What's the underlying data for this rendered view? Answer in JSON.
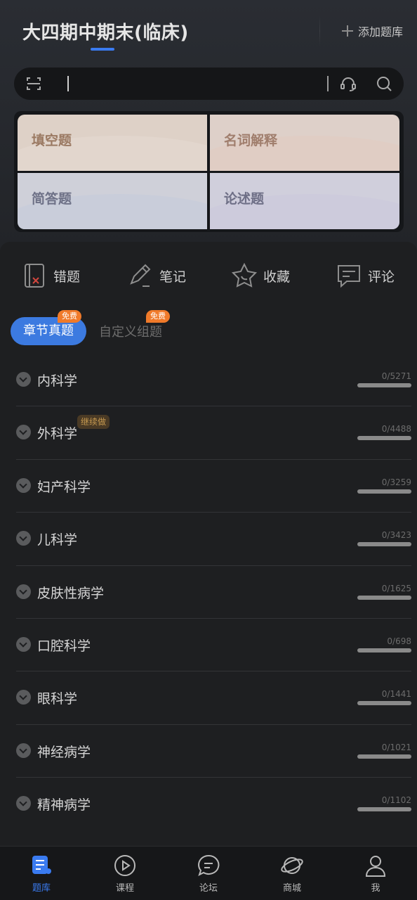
{
  "header": {
    "title": "大四期中期末(临床)",
    "add_bank_label": "添加题库"
  },
  "search": {
    "value": "",
    "icons": [
      "scan-icon",
      "headset-icon",
      "search-icon"
    ]
  },
  "categories": [
    {
      "label": "填空题"
    },
    {
      "label": "名词解释"
    },
    {
      "label": "简答题"
    },
    {
      "label": "论述题"
    }
  ],
  "tools": [
    {
      "label": "错题",
      "icon": "wrong-book-icon"
    },
    {
      "label": "笔记",
      "icon": "pencil-icon"
    },
    {
      "label": "收藏",
      "icon": "star-icon"
    },
    {
      "label": "评论",
      "icon": "comment-icon"
    }
  ],
  "modes": {
    "active": "章节真题",
    "inactive": "自定义组题",
    "free_badge": "免费"
  },
  "chapters": [
    {
      "name": "内科学",
      "count": "0/5271",
      "progress": 0
    },
    {
      "name": "外科学",
      "count": "0/4488",
      "progress": 0,
      "badge": "继续做"
    },
    {
      "name": "妇产科学",
      "count": "0/3259",
      "progress": 0
    },
    {
      "name": "儿科学",
      "count": "0/3423",
      "progress": 0
    },
    {
      "name": "皮肤性病学",
      "count": "0/1625",
      "progress": 0
    },
    {
      "name": "口腔科学",
      "count": "0/698",
      "progress": 0
    },
    {
      "name": "眼科学",
      "count": "0/1441",
      "progress": 0
    },
    {
      "name": "神经病学",
      "count": "0/1021",
      "progress": 0
    },
    {
      "name": "精神病学",
      "count": "0/1102",
      "progress": 0
    }
  ],
  "tabbar": [
    {
      "label": "题库",
      "active": true,
      "icon": "question-bank-icon"
    },
    {
      "label": "课程",
      "active": false,
      "icon": "play-icon"
    },
    {
      "label": "论坛",
      "active": false,
      "icon": "chat-icon"
    },
    {
      "label": "商城",
      "active": false,
      "icon": "planet-icon"
    },
    {
      "label": "我",
      "active": false,
      "icon": "user-icon"
    }
  ],
  "colors": {
    "accent": "#3a7bf0",
    "badge_orange": "#f07a2a",
    "background": "#1e1f21"
  }
}
